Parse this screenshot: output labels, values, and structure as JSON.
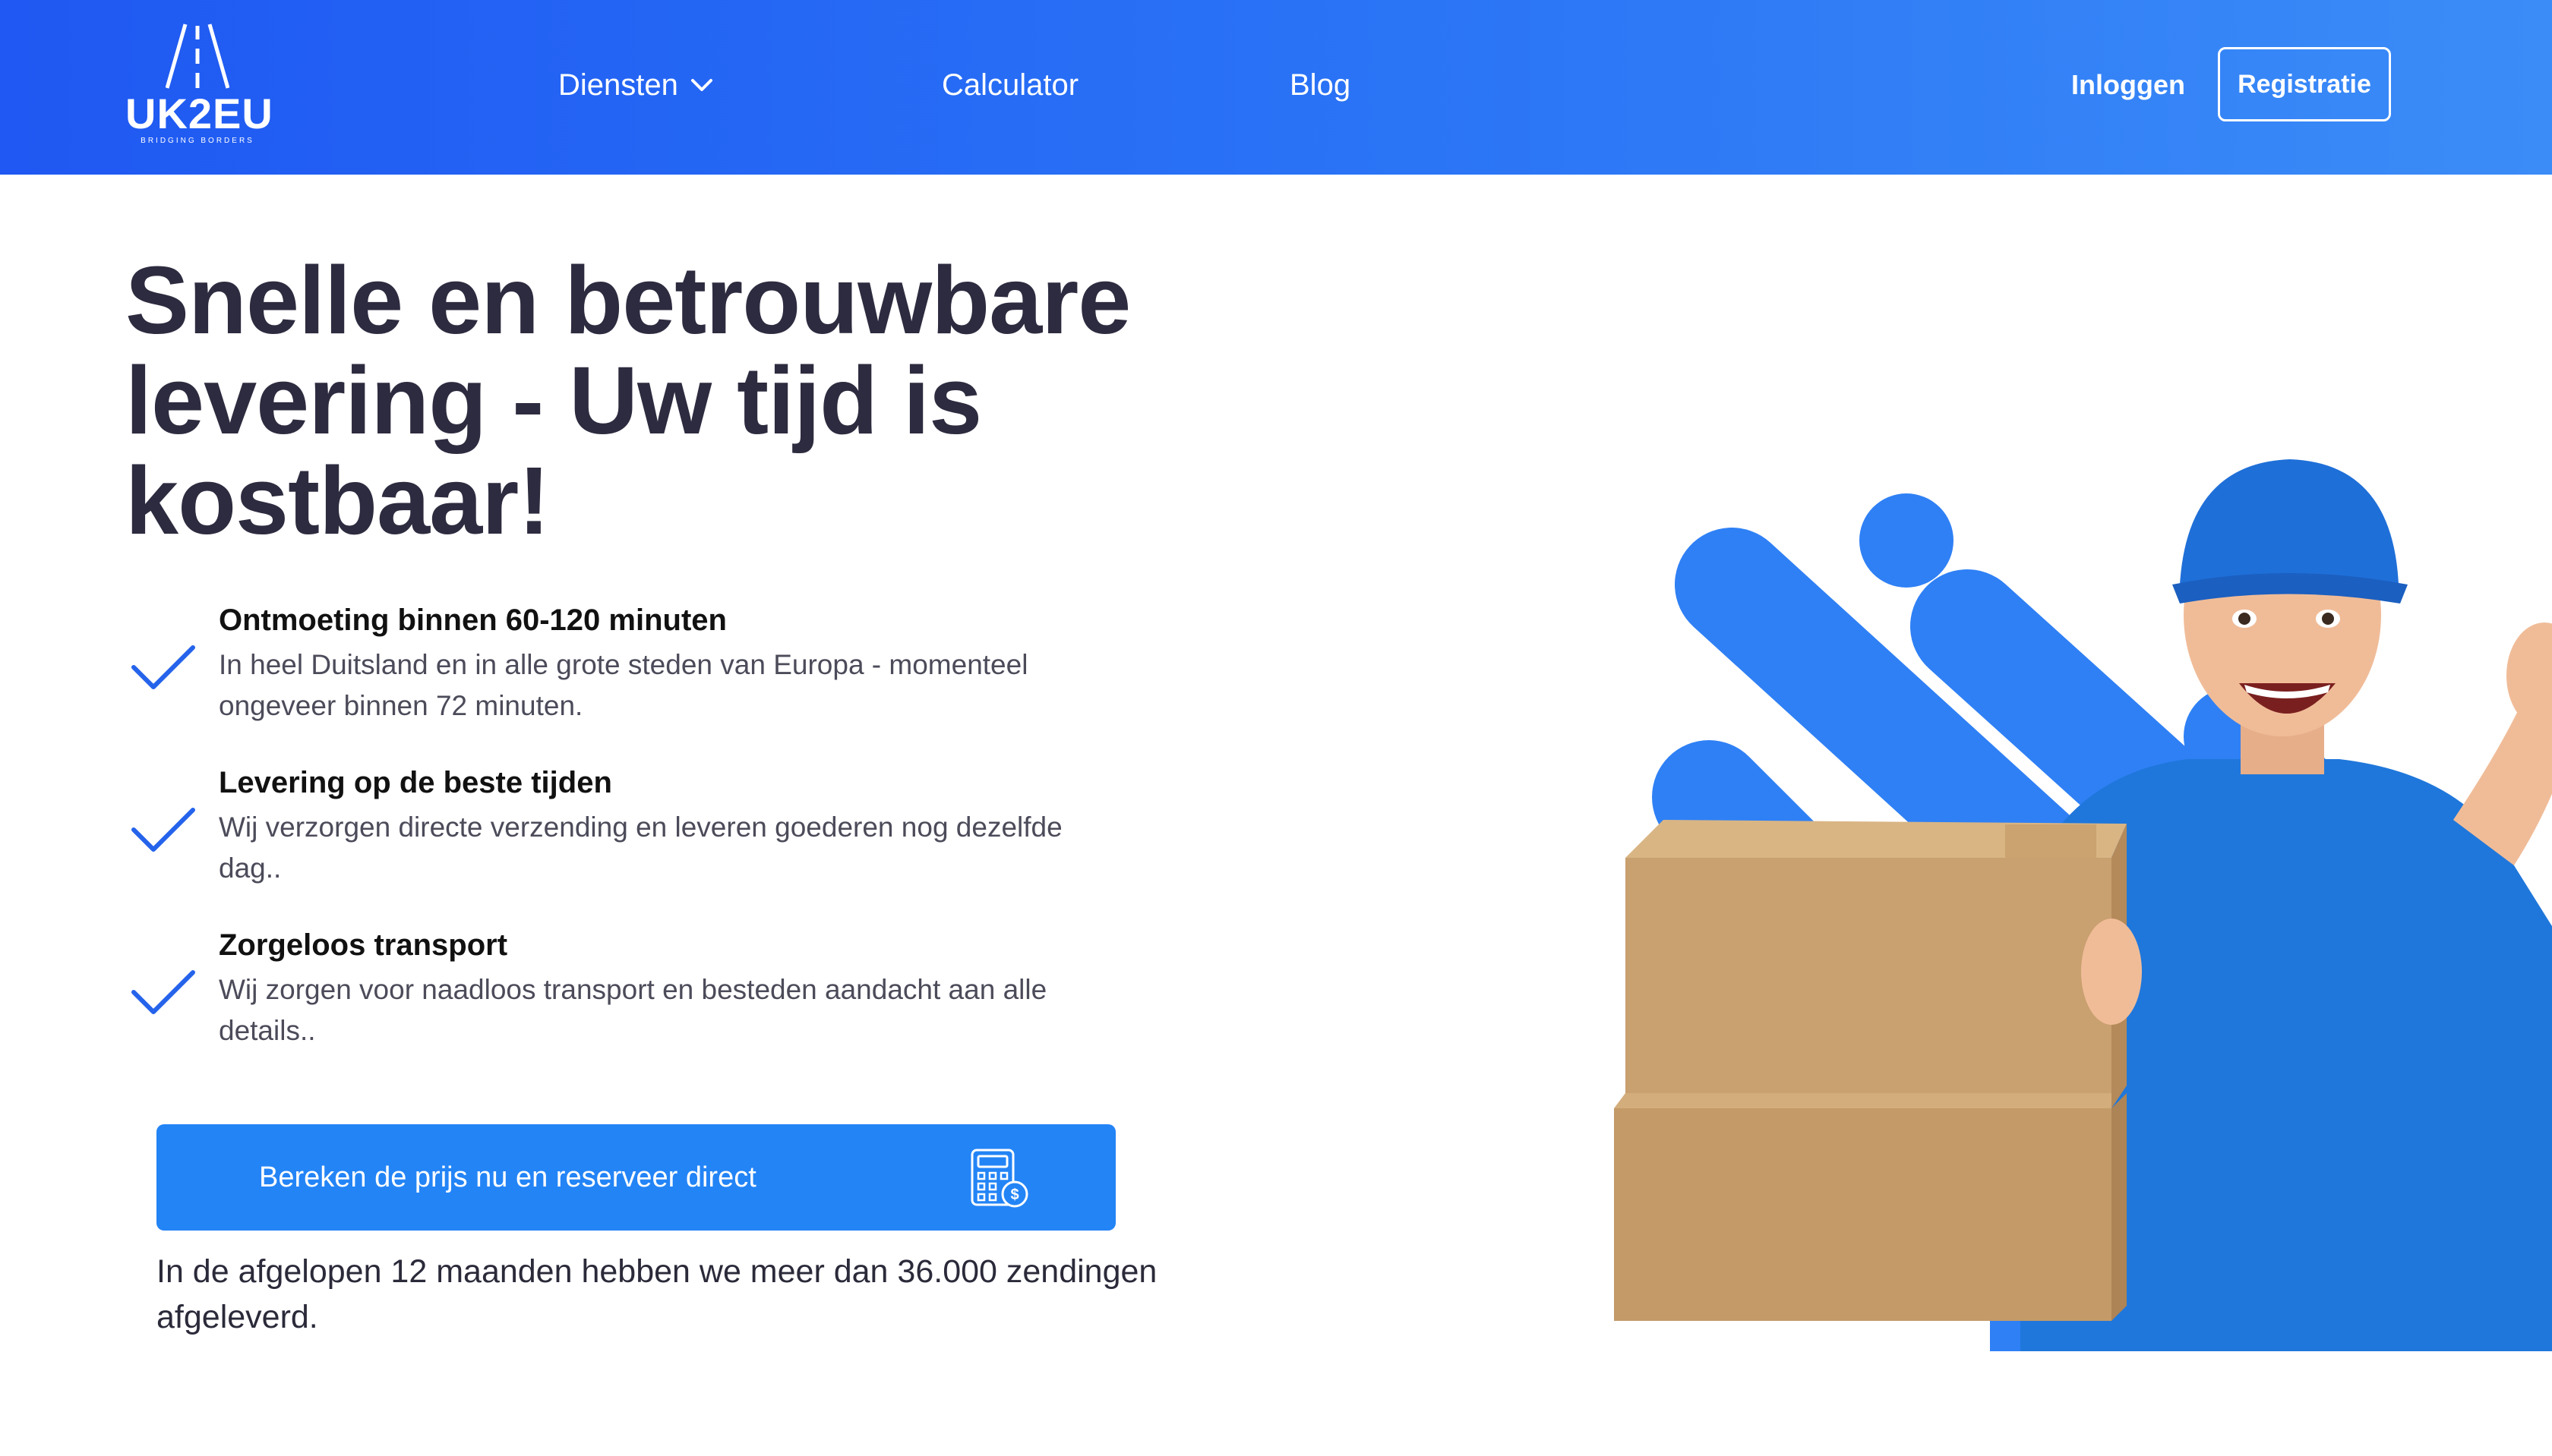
{
  "header": {
    "logo": {
      "name": "UK2EU",
      "tagline": "BRIDGING BORDERS"
    },
    "nav": [
      {
        "label": "Diensten"
      },
      {
        "label": "Calculator"
      },
      {
        "label": "Blog"
      }
    ],
    "login_label": "Inloggen",
    "register_label": "Registratie"
  },
  "hero": {
    "title": "Snelle en betrouwbare levering - Uw tijd is kostbaar!",
    "features": [
      {
        "title": "Ontmoeting binnen 60-120 minuten",
        "description": "In heel Duitsland en in alle grote steden van Europa - momenteel ongeveer binnen 72 minuten."
      },
      {
        "title": "Levering op de beste tijden",
        "description": "Wij verzorgen directe verzending en leveren goederen nog dezelfde dag.."
      },
      {
        "title": "Zorgeloos transport",
        "description": "Wij zorgen voor naadloos transport en besteden aandacht aan alle details.."
      }
    ],
    "cta_label": "Bereken de prijs nu en reserveer direct",
    "stats_note": "In de afgelopen 12 maanden hebben we meer dan 36.000 zendingen afgeleverd."
  },
  "icons": {
    "check": "check-icon",
    "chevron": "chevron-down-icon",
    "calculator": "calculator-icon"
  },
  "colors": {
    "header_gradient_start": "#1f58f2",
    "header_gradient_end": "#3b8cf7",
    "primary_button": "#2384f6",
    "check_color": "#2563eb",
    "heading": "#2d2b3f"
  }
}
